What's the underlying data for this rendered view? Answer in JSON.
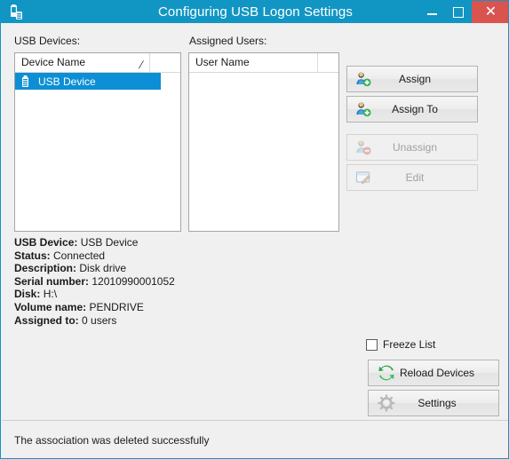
{
  "window": {
    "title": "Configuring USB Logon Settings",
    "app_icon": "usb-device-icon",
    "accent_color": "#1196c4",
    "close_color": "#d9544f"
  },
  "titlebar_buttons": {
    "minimize": "minimize-icon",
    "maximize": "maximize-icon",
    "close": "close-icon"
  },
  "devices_panel": {
    "label": "USB Devices:",
    "columns": [
      "Device Name"
    ],
    "sort_indicator": "/",
    "rows": [
      {
        "icon": "usb-drive-icon",
        "name": "USB Device",
        "selected": true
      }
    ]
  },
  "users_panel": {
    "label": "Assigned Users:",
    "columns": [
      "User Name"
    ],
    "rows": []
  },
  "action_buttons": [
    {
      "label": "Assign",
      "icon": "user-add-icon",
      "enabled": true
    },
    {
      "label": "Assign To",
      "icon": "user-add-icon",
      "enabled": true
    },
    {
      "label": "Unassign",
      "icon": "user-remove-icon",
      "enabled": false
    },
    {
      "label": "Edit",
      "icon": "edit-pencil-icon",
      "enabled": false
    }
  ],
  "details": {
    "usb_device_label": "USB Device:",
    "usb_device_value": "USB Device",
    "status_label": "Status:",
    "status_value": "Connected",
    "description_label": "Description:",
    "description_value": "Disk drive",
    "serial_label": "Serial number:",
    "serial_value": "12010990001052",
    "disk_label": "Disk:",
    "disk_value": "H:\\",
    "volume_label": "Volume name:",
    "volume_value": "PENDRIVE",
    "assigned_label": "Assigned to:",
    "assigned_value": "0 users"
  },
  "freeze_list": {
    "label": "Freeze List",
    "checked": false
  },
  "bottom_buttons": [
    {
      "label": "Reload Devices",
      "icon": "refresh-icon",
      "enabled": true
    },
    {
      "label": "Settings",
      "icon": "gear-icon",
      "enabled": true
    }
  ],
  "statusbar": {
    "message": "The association was deleted successfully"
  }
}
